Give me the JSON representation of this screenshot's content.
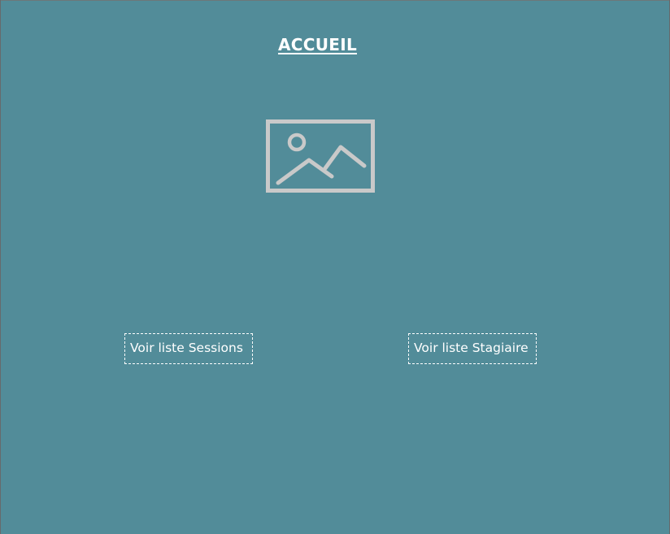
{
  "page": {
    "title": "ACCUEIL",
    "background_color": "#528c99",
    "image_placeholder_icon": "image-placeholder-icon"
  },
  "actions": {
    "sessions_label": "Voir liste Sessions",
    "stagiaire_label": "Voir liste Stagiaire"
  }
}
